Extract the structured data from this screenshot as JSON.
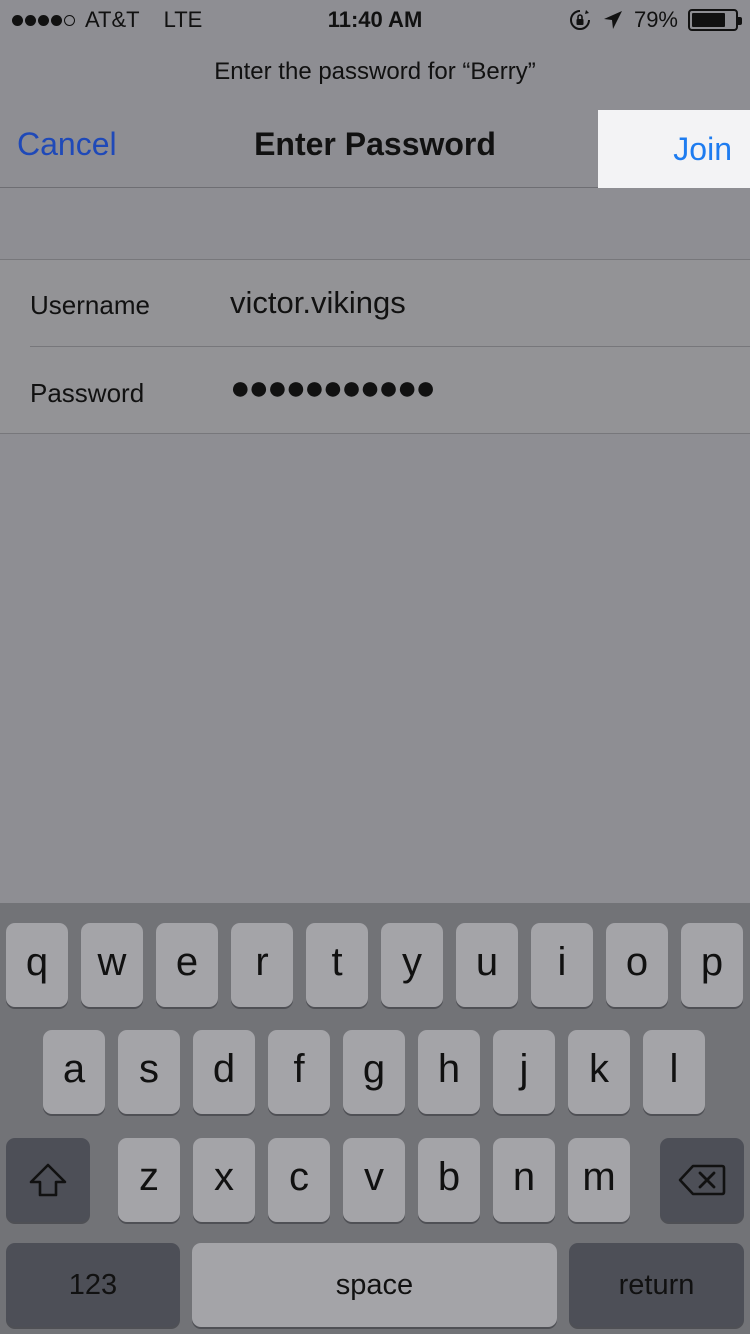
{
  "status_bar": {
    "carrier": "AT&T",
    "network": "LTE",
    "time": "11:40 AM",
    "battery": "79%",
    "battery_level": 0.79,
    "signal_bars_filled": 4,
    "signal_bars_total": 5
  },
  "prompt": "Enter the password for “Berry”",
  "nav": {
    "cancel": "Cancel",
    "title": "Enter Password",
    "join": "Join"
  },
  "form": {
    "username_label": "Username",
    "username_value": "victor.vikings",
    "password_label": "Password",
    "password_value": "●●●●●●●●●●●"
  },
  "keyboard": {
    "row1": [
      "q",
      "w",
      "e",
      "r",
      "t",
      "y",
      "u",
      "i",
      "o",
      "p"
    ],
    "row2": [
      "a",
      "s",
      "d",
      "f",
      "g",
      "h",
      "j",
      "k",
      "l"
    ],
    "row3": [
      "z",
      "x",
      "c",
      "v",
      "b",
      "n",
      "m"
    ],
    "numbers": "123",
    "space": "space",
    "return": "return"
  },
  "colors": {
    "cancel": "#1f49b8",
    "join": "#1e7cf0",
    "join_bg": "#f3f3f5"
  }
}
